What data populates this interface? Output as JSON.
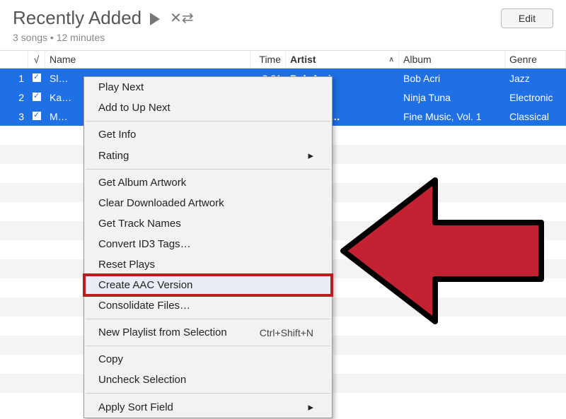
{
  "header": {
    "title": "Recently Added",
    "subtitle": "3 songs • 12 minutes",
    "edit_label": "Edit"
  },
  "columns": {
    "name": "Name",
    "time": "Time",
    "artist": "Artist",
    "album": "Album",
    "genre": "Genre"
  },
  "rows": [
    {
      "num": "1",
      "name": "Sl…",
      "time": "3:21",
      "artist": "Bob Acri",
      "album": "Bob Acri",
      "genre": "Jazz"
    },
    {
      "num": "2",
      "name": "Ka…",
      "time": "",
      "artist": "",
      "album": "Ninja Tuna",
      "genre": "Electronic"
    },
    {
      "num": "3",
      "name": "M…",
      "time": "",
      "artist": "oltzman/…",
      "album": "Fine Music, Vol. 1",
      "genre": "Classical"
    }
  ],
  "menu": {
    "play_next": "Play Next",
    "add_up_next": "Add to Up Next",
    "get_info": "Get Info",
    "rating": "Rating",
    "get_artwork": "Get Album Artwork",
    "clear_artwork": "Clear Downloaded Artwork",
    "get_track_names": "Get Track Names",
    "convert_id3": "Convert ID3 Tags…",
    "reset_plays": "Reset Plays",
    "create_aac": "Create AAC Version",
    "consolidate": "Consolidate Files…",
    "new_playlist": "New Playlist from Selection",
    "new_playlist_shortcut": "Ctrl+Shift+N",
    "copy": "Copy",
    "uncheck": "Uncheck Selection",
    "apply_sort": "Apply Sort Field"
  }
}
